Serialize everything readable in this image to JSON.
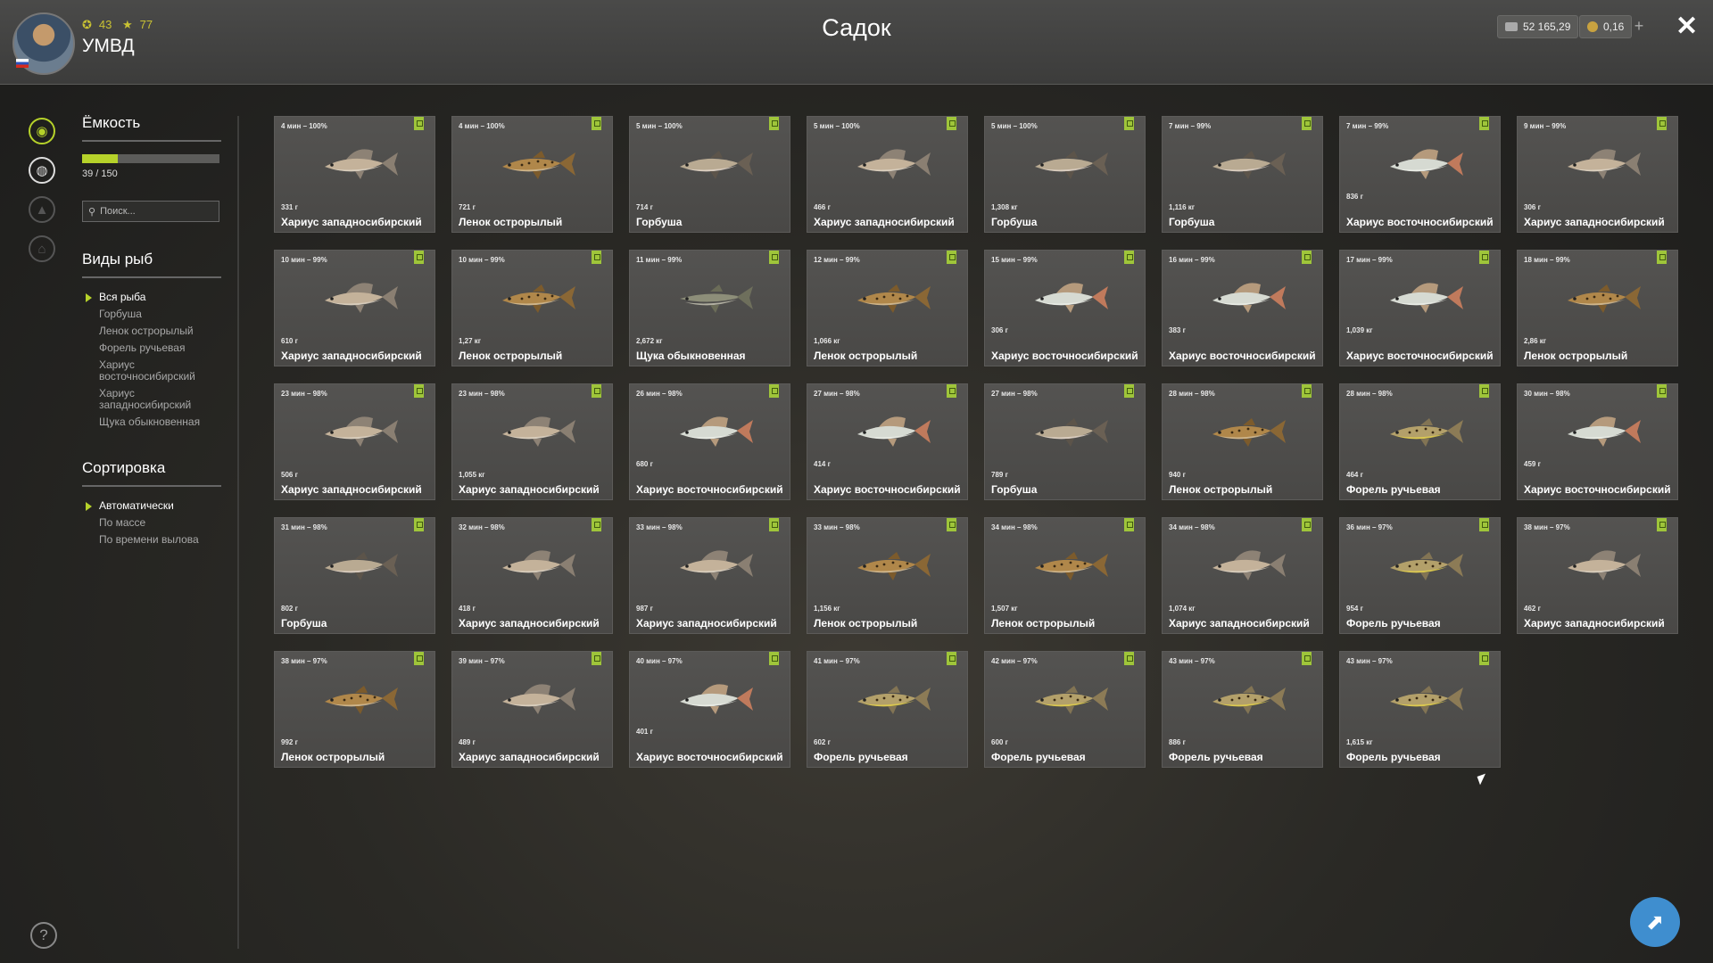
{
  "header": {
    "title": "Садок",
    "player_name": "УМВД",
    "level": "43",
    "rank": "77",
    "money_silver": "52 165,29",
    "money_gold": "0,16"
  },
  "capacity": {
    "title": "Ёмкость",
    "text": "39 / 150",
    "fraction": 0.26
  },
  "search": {
    "placeholder": "Поиск..."
  },
  "species": {
    "title": "Виды рыб",
    "items": [
      "Вся рыба",
      "Горбуша",
      "Ленок острорылый",
      "Форель ручьевая",
      "Хариус восточносибирский",
      "Хариус западносибирский",
      "Щука обыкновенная"
    ]
  },
  "sort": {
    "title": "Сортировка",
    "items": [
      "Автоматически",
      "По массе",
      "По времени вылова"
    ]
  },
  "colors": {
    "accent": "#b6d22a",
    "card": "#4f4e4c"
  },
  "fish": [
    {
      "time": "4 мин – 100%",
      "weight": "331 г",
      "name": "Хариус западносибирский",
      "kind": "grayling"
    },
    {
      "time": "4 мин – 100%",
      "weight": "721 г",
      "name": "Ленок острорылый",
      "kind": "lenok"
    },
    {
      "time": "5 мин – 100%",
      "weight": "714 г",
      "name": "Горбуша",
      "kind": "pink"
    },
    {
      "time": "5 мин – 100%",
      "weight": "466 г",
      "name": "Хариус западносибирский",
      "kind": "grayling"
    },
    {
      "time": "5 мин – 100%",
      "weight": "1,308 кг",
      "name": "Горбуша",
      "kind": "pink"
    },
    {
      "time": "7 мин – 99%",
      "weight": "1,116 кг",
      "name": "Горбуша",
      "kind": "pink"
    },
    {
      "time": "7 мин – 99%",
      "weight": "836 г",
      "name": "Хариус восточносибирский",
      "kind": "egrayling"
    },
    {
      "time": "9 мин – 99%",
      "weight": "306 г",
      "name": "Хариус западносибирский",
      "kind": "grayling"
    },
    {
      "time": "10 мин – 99%",
      "weight": "610 г",
      "name": "Хариус западносибирский",
      "kind": "grayling"
    },
    {
      "time": "10 мин – 99%",
      "weight": "1,27 кг",
      "name": "Ленок острорылый",
      "kind": "lenok"
    },
    {
      "time": "11 мин – 99%",
      "weight": "2,672 кг",
      "name": "Щука обыкновенная",
      "kind": "pike"
    },
    {
      "time": "12 мин – 99%",
      "weight": "1,066 кг",
      "name": "Ленок острорылый",
      "kind": "lenok"
    },
    {
      "time": "15 мин – 99%",
      "weight": "306 г",
      "name": "Хариус восточносибирский",
      "kind": "egrayling"
    },
    {
      "time": "16 мин – 99%",
      "weight": "383 г",
      "name": "Хариус восточносибирский",
      "kind": "egrayling"
    },
    {
      "time": "17 мин – 99%",
      "weight": "1,039 кг",
      "name": "Хариус восточносибирский",
      "kind": "egrayling"
    },
    {
      "time": "18 мин – 99%",
      "weight": "2,86 кг",
      "name": "Ленок острорылый",
      "kind": "lenok"
    },
    {
      "time": "23 мин – 98%",
      "weight": "506 г",
      "name": "Хариус западносибирский",
      "kind": "grayling"
    },
    {
      "time": "23 мин – 98%",
      "weight": "1,055 кг",
      "name": "Хариус западносибирский",
      "kind": "grayling"
    },
    {
      "time": "26 мин – 98%",
      "weight": "680 г",
      "name": "Хариус восточносибирский",
      "kind": "egrayling"
    },
    {
      "time": "27 мин – 98%",
      "weight": "414 г",
      "name": "Хариус восточносибирский",
      "kind": "egrayling"
    },
    {
      "time": "27 мин – 98%",
      "weight": "789 г",
      "name": "Горбуша",
      "kind": "pink"
    },
    {
      "time": "28 мин – 98%",
      "weight": "940 г",
      "name": "Ленок острорылый",
      "kind": "lenok"
    },
    {
      "time": "28 мин – 98%",
      "weight": "464 г",
      "name": "Форель ручьевая",
      "kind": "trout"
    },
    {
      "time": "30 мин – 98%",
      "weight": "459 г",
      "name": "Хариус восточносибирский",
      "kind": "egrayling"
    },
    {
      "time": "31 мин – 98%",
      "weight": "802 г",
      "name": "Горбуша",
      "kind": "pink"
    },
    {
      "time": "32 мин – 98%",
      "weight": "418 г",
      "name": "Хариус западносибирский",
      "kind": "grayling"
    },
    {
      "time": "33 мин – 98%",
      "weight": "987 г",
      "name": "Хариус западносибирский",
      "kind": "grayling"
    },
    {
      "time": "33 мин – 98%",
      "weight": "1,156 кг",
      "name": "Ленок острорылый",
      "kind": "lenok"
    },
    {
      "time": "34 мин – 98%",
      "weight": "1,507 кг",
      "name": "Ленок острорылый",
      "kind": "lenok"
    },
    {
      "time": "34 мин – 98%",
      "weight": "1,074 кг",
      "name": "Хариус западносибирский",
      "kind": "grayling"
    },
    {
      "time": "36 мин – 97%",
      "weight": "954 г",
      "name": "Форель ручьевая",
      "kind": "trout"
    },
    {
      "time": "38 мин – 97%",
      "weight": "462 г",
      "name": "Хариус западносибирский",
      "kind": "grayling"
    },
    {
      "time": "38 мин – 97%",
      "weight": "992 г",
      "name": "Ленок острорылый",
      "kind": "lenok"
    },
    {
      "time": "39 мин – 97%",
      "weight": "489 г",
      "name": "Хариус западносибирский",
      "kind": "grayling"
    },
    {
      "time": "40 мин – 97%",
      "weight": "401 г",
      "name": "Хариус восточносибирский",
      "kind": "egrayling"
    },
    {
      "time": "41 мин – 97%",
      "weight": "602 г",
      "name": "Форель ручьевая",
      "kind": "trout"
    },
    {
      "time": "42 мин – 97%",
      "weight": "600 г",
      "name": "Форель ручьевая",
      "kind": "trout"
    },
    {
      "time": "43 мин – 97%",
      "weight": "886 г",
      "name": "Форель ручьевая",
      "kind": "trout"
    },
    {
      "time": "43 мин – 97%",
      "weight": "1,615 кг",
      "name": "Форель ручьевая",
      "kind": "trout"
    }
  ]
}
